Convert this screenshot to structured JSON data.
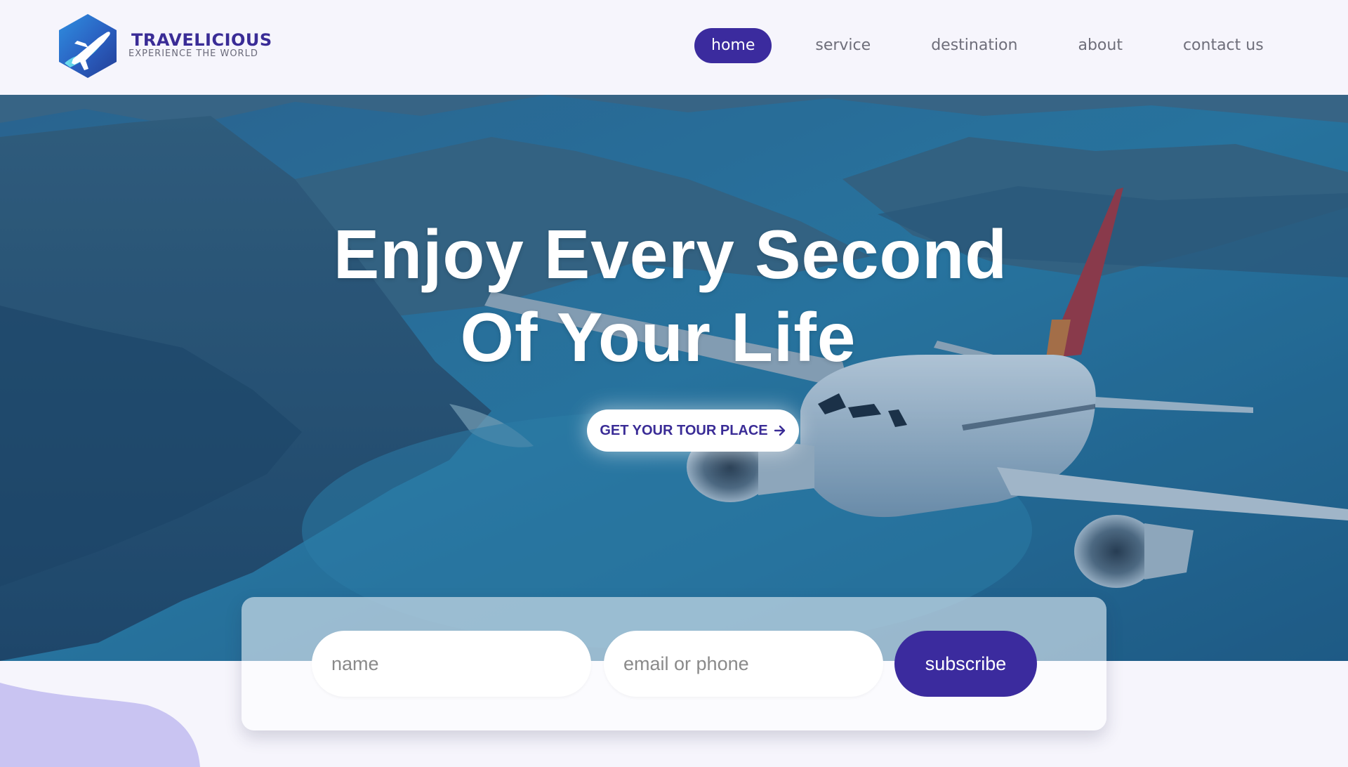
{
  "brand": {
    "name": "TRAVELICIOUS",
    "tagline": "EXPERIENCE THE WORLD",
    "logo_icon": "plane-hexagon-icon",
    "colors": {
      "primary": "#3b2b9e",
      "logo_blue": "#2a5fc0",
      "logo_cyan": "#5ad0e8"
    }
  },
  "nav": {
    "items": [
      {
        "label": "home",
        "active": true
      },
      {
        "label": "service",
        "active": false
      },
      {
        "label": "destination",
        "active": false
      },
      {
        "label": "about",
        "active": false
      },
      {
        "label": "contact us",
        "active": false
      }
    ]
  },
  "hero": {
    "title_line1": "Enjoy Every Second",
    "title_line2": "Of Your Life",
    "cta_label": "GET YOUR TOUR PLACE",
    "cta_icon": "arrow-right-icon",
    "background": "airplane-over-coastline-photo"
  },
  "subscribe": {
    "name_placeholder": "name",
    "contact_placeholder": "email or phone",
    "button_label": "subscribe"
  }
}
